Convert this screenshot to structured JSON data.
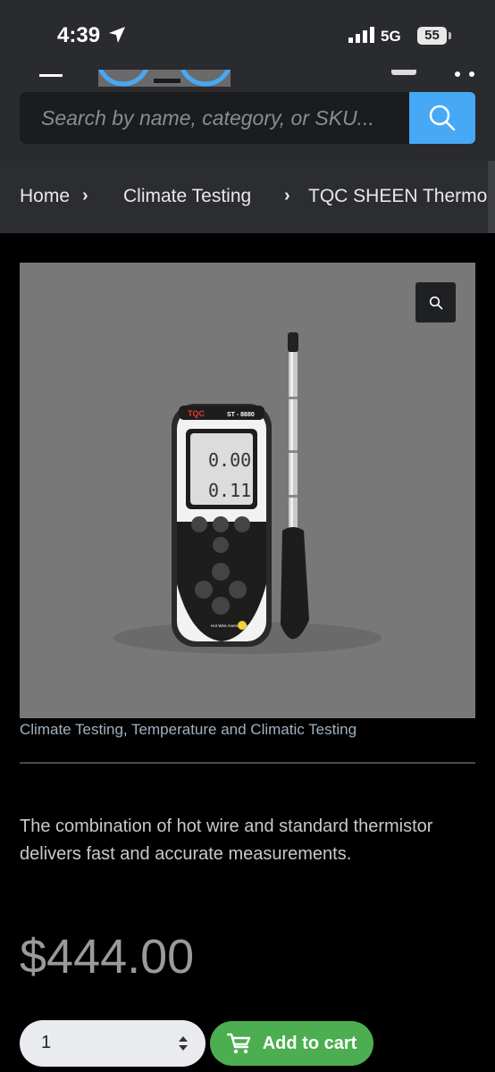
{
  "status_bar": {
    "time": "4:39",
    "network": "5G",
    "battery": "55"
  },
  "search": {
    "placeholder": "Search by name, category, or SKU..."
  },
  "breadcrumb": {
    "home": "Home",
    "category": "Climate Testing",
    "current": "TQC SHEEN Thermo-Anemometer"
  },
  "product": {
    "device_brand": "TQC",
    "device_model": "ST - 8880",
    "display_top": "0.00",
    "display_bottom": "0.11",
    "device_caption": "Hot Wire Anemometer",
    "categories": [
      "Climate Testing",
      "Temperature and Climatic Testing"
    ],
    "category_separator": ", ",
    "description": "The combination of hot wire and standard thermistor delivers fast and accurate measurements.",
    "price": "$444.00"
  },
  "cart": {
    "quantity": "1",
    "add_label": "Add to cart"
  },
  "colors": {
    "accent_blue": "#47a8f5",
    "cart_green": "#4cae50",
    "header_bg": "#2a2b2e"
  }
}
